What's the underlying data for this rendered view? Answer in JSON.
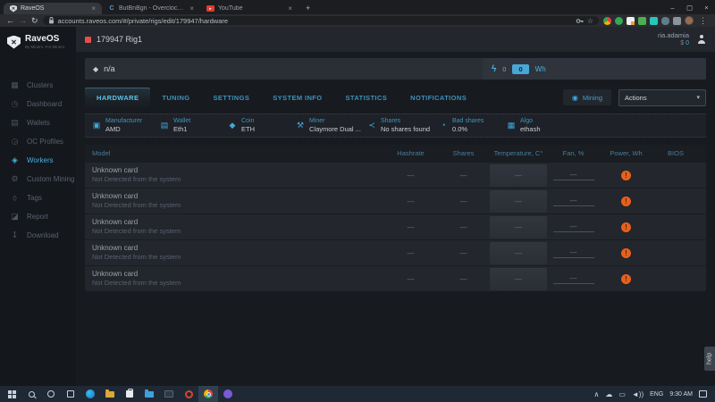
{
  "colors": {
    "accent": "#3fa9dc",
    "warning": "#e8611c",
    "danger": "#e34f4f",
    "badge_blue": "#49a7d4"
  },
  "browser": {
    "tabs": [
      {
        "title": "RaveOS"
      },
      {
        "title": "ButBnBgn - Overclockers GE - B"
      },
      {
        "title": "YouTube"
      }
    ],
    "url": "accounts.raveos.com/#/private/rigs/edit/179947/hardware"
  },
  "sidebar": {
    "brand": "RaveOS",
    "tagline": "By Miners. For Miners.",
    "items": [
      {
        "label": "Clusters"
      },
      {
        "label": "Dashboard"
      },
      {
        "label": "Wallets"
      },
      {
        "label": "OC Profiles"
      },
      {
        "label": "Workers"
      },
      {
        "label": "Custom Mining"
      },
      {
        "label": "Tags"
      },
      {
        "label": "Report"
      },
      {
        "label": "Download"
      }
    ]
  },
  "header": {
    "rig_title": "179947 Rig1",
    "user_name": "ria.adamia",
    "balance_currency": "$",
    "balance_value": "0"
  },
  "rig": {
    "name": "n/a",
    "power_value": "0",
    "power_badge": "0",
    "power_unit": "Wh"
  },
  "tabs": [
    {
      "label": "HARDWARE"
    },
    {
      "label": "TUNING"
    },
    {
      "label": "SETTINGS"
    },
    {
      "label": "SYSTEM INFO"
    },
    {
      "label": "STATISTICS"
    },
    {
      "label": "NOTIFICATIONS"
    }
  ],
  "toolbar": {
    "mining_label": "Mining",
    "actions_label": "Actions"
  },
  "info": [
    {
      "label": "Manufacturer",
      "value": "AMD"
    },
    {
      "label": "Wallet",
      "value": "Eth1"
    },
    {
      "label": "Coin",
      "value": "ETH"
    },
    {
      "label": "Miner",
      "value": "Claymore Dual ..."
    },
    {
      "label": "Shares",
      "value": "No shares found"
    },
    {
      "label": "Bad shares",
      "value": "0.0%"
    },
    {
      "label": "Algo",
      "value": "ethash"
    }
  ],
  "table": {
    "headers": [
      "Model",
      "Hashrate",
      "Shares",
      "Temperature, C°",
      "Fan, %",
      "Power, Wh",
      "BIOS"
    ],
    "rows": [
      {
        "model": "Unknown card",
        "model_sub": "Not Detected from the system",
        "hashrate": "—",
        "shares": "—",
        "temperature": "—",
        "fan": "—"
      },
      {
        "model": "Unknown card",
        "model_sub": "Not Detected from the system",
        "hashrate": "—",
        "shares": "—",
        "temperature": "—",
        "fan": "—"
      },
      {
        "model": "Unknown card",
        "model_sub": "Not Detected from the system",
        "hashrate": "—",
        "shares": "—",
        "temperature": "—",
        "fan": "—"
      },
      {
        "model": "Unknown card",
        "model_sub": "Not Detected from the system",
        "hashrate": "—",
        "shares": "—",
        "temperature": "—",
        "fan": "—"
      },
      {
        "model": "Unknown card",
        "model_sub": "Not Detected from the system",
        "hashrate": "—",
        "shares": "—",
        "temperature": "—",
        "fan": "—"
      }
    ]
  },
  "help_label": "help",
  "taskbar": {
    "lang": "ENG",
    "time": "9:30 AM"
  },
  "icons": {
    "lightning": "ϟ",
    "eth": "◆",
    "warning": "!",
    "clusters": "▦",
    "dashboard": "◷",
    "wallets": "▤",
    "oc_profiles": "◶",
    "workers": "◈",
    "custom_mining": "⚙",
    "tags": "◊",
    "report": "◪",
    "download": "↧",
    "manufacturer": "▣",
    "wallet": "▤",
    "coin": "◆",
    "miner": "⚒",
    "shares": "≺",
    "bad_shares": "◔",
    "algo": "▦",
    "back": "←",
    "forward": "→",
    "reload": "↻",
    "menu": "⋮",
    "star": "☆",
    "plus": "+",
    "minimize": "–",
    "maximize": "▢",
    "close": "×",
    "chevron_down": "▾",
    "chevron_up": "∧",
    "cloud": "☁",
    "display": "▭",
    "speaker": "◄))",
    "mining_status": "◉",
    "play": "▸",
    "shield_mark": "✕"
  }
}
